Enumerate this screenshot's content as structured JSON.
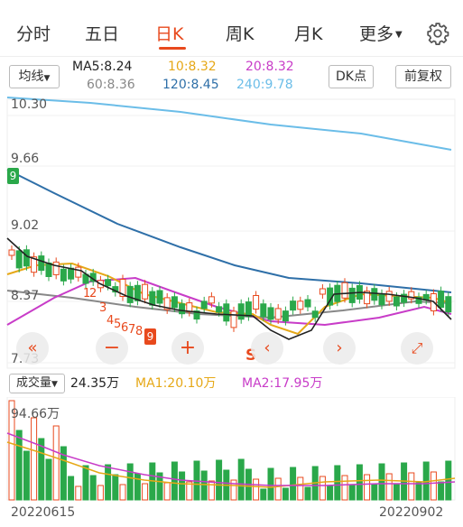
{
  "tabs": [
    {
      "label": "分时",
      "active": false
    },
    {
      "label": "五日",
      "active": false
    },
    {
      "label": "日K",
      "active": true
    },
    {
      "label": "周K",
      "active": false
    },
    {
      "label": "月K",
      "active": false
    },
    {
      "label": "更多",
      "active": false
    }
  ],
  "ma_selector": "均线",
  "ma": {
    "ma5": "MA5:8.24",
    "ma10": "10:8.32",
    "ma20": "20:8.32",
    "ma60": "60:8.36",
    "ma120": "120:8.45",
    "ma240": "240:9.78"
  },
  "buttons": {
    "dk": "DK点",
    "adjust": "前复权"
  },
  "price_axis": [
    "10.30",
    "9.66",
    "9.02",
    "8.37",
    "7.73"
  ],
  "seq_markers": [
    "1",
    "2",
    "3",
    "4",
    "5",
    "6",
    "7",
    "8",
    "9"
  ],
  "seq_badge": "9",
  "left_badge": "9",
  "s_marker": "S",
  "volume": {
    "selector": "成交量",
    "current": "24.35万",
    "ma1": "MA1:20.10万",
    "ma2": "MA2:17.95万",
    "max": "94.66万"
  },
  "dates": {
    "start": "20220615",
    "end": "20220902"
  },
  "colors": {
    "up": "#e8491d",
    "down": "#2aa84a",
    "accent": "#e8491d",
    "ma5": "#222222",
    "ma10": "#e6a817",
    "ma20": "#c83cc8",
    "ma60": "#888888",
    "ma120": "#2e6fa8",
    "ma240": "#6bbde8"
  }
}
